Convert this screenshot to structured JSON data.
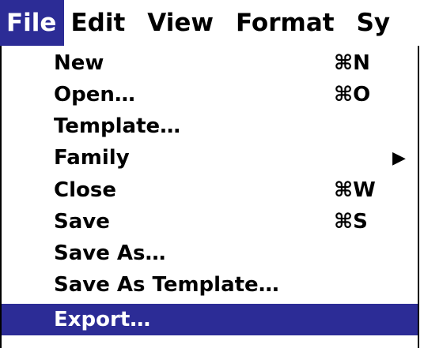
{
  "menubar": {
    "items": [
      {
        "label": "File",
        "active": true
      },
      {
        "label": "Edit"
      },
      {
        "label": "View"
      },
      {
        "label": "Format"
      },
      {
        "label": "Sy"
      }
    ]
  },
  "file_menu": {
    "items": [
      {
        "label": "New",
        "shortcut": "⌘N"
      },
      {
        "label": "Open…",
        "shortcut": "⌘O"
      },
      {
        "label": "Template…",
        "shortcut": ""
      },
      {
        "label": "Family",
        "submenu_arrow": "▶"
      },
      {
        "label": "Close",
        "shortcut": "⌘W"
      },
      {
        "label": "Save",
        "shortcut": "⌘S"
      },
      {
        "label": "Save As…",
        "shortcut": ""
      },
      {
        "label": "Save As Template…",
        "shortcut": ""
      },
      {
        "label": "Export…",
        "shortcut": "",
        "highlighted": true
      }
    ]
  },
  "colors": {
    "highlight": "#2c2c96",
    "text": "#000000",
    "highlight_text": "#ffffff",
    "background": "#ffffff"
  }
}
